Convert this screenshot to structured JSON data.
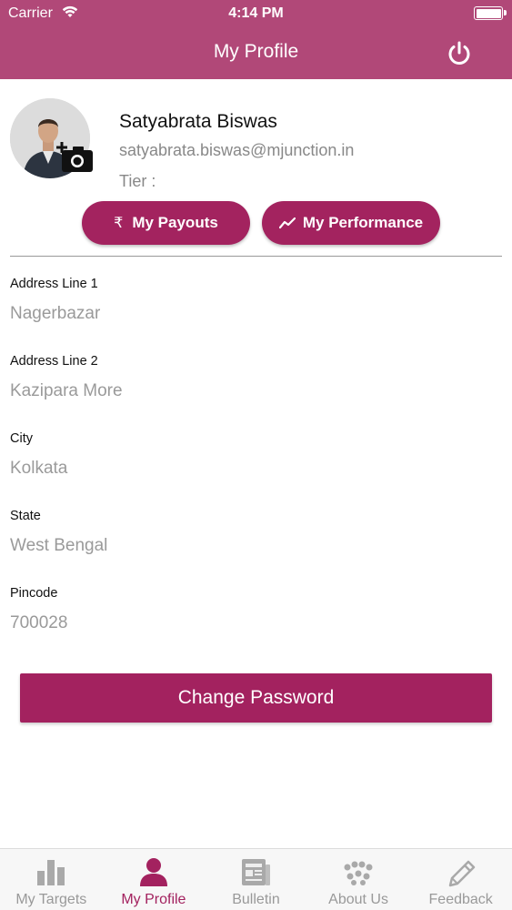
{
  "status_bar": {
    "carrier": "Carrier",
    "time": "4:14 PM",
    "wifi_icon": "wifi-icon",
    "battery_icon": "battery-full-icon"
  },
  "header": {
    "title": "My Profile",
    "power_icon": "power-icon"
  },
  "profile": {
    "name": "Satyabrata Biswas",
    "email": "satyabrata.biswas@mjunction.in",
    "tier_label": "Tier :",
    "camera_icon": "camera-add-icon"
  },
  "actions": {
    "payouts": {
      "icon_glyph": "₹",
      "label": "My Payouts"
    },
    "performance": {
      "icon": "trend-line-icon",
      "label": "My Performance"
    }
  },
  "fields": [
    {
      "label": "Address Line 1",
      "value": "Nagerbazar"
    },
    {
      "label": "Address Line 2",
      "value": "Kazipara More"
    },
    {
      "label": "City",
      "value": "Kolkata"
    },
    {
      "label": "State",
      "value": "West Bengal"
    },
    {
      "label": "Pincode",
      "value": "700028"
    }
  ],
  "change_password": {
    "label": "Change Password"
  },
  "tabs": [
    {
      "label": "My Targets",
      "icon": "bar-chart-icon",
      "active": false
    },
    {
      "label": "My Profile",
      "icon": "person-icon",
      "active": true
    },
    {
      "label": "Bulletin",
      "icon": "newspaper-icon",
      "active": false
    },
    {
      "label": "About Us",
      "icon": "people-group-icon",
      "active": false
    },
    {
      "label": "Feedback",
      "icon": "pencil-icon",
      "active": false
    }
  ],
  "colors": {
    "header_bg": "#b14878",
    "accent": "#a3225f",
    "inactive_tab": "#999999",
    "field_value": "#9a9a9a"
  }
}
